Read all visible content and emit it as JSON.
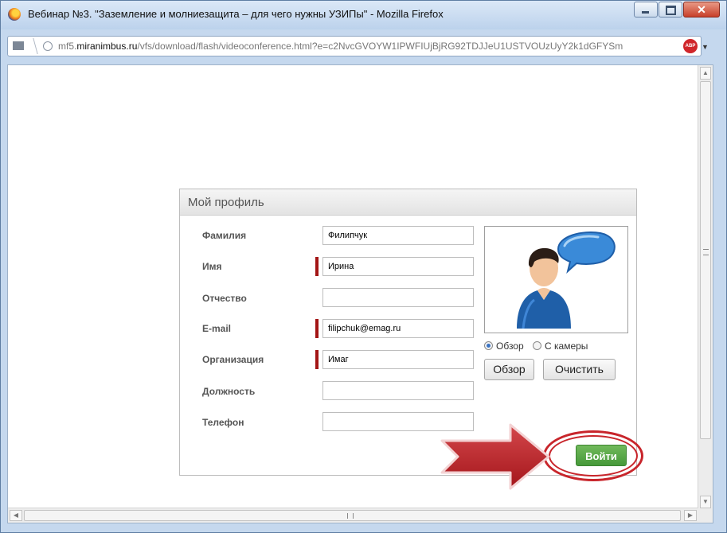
{
  "window": {
    "title": "Вебинар №3. \"Заземление и молниезащита – для чего нужны УЗИПы\" - Mozilla Firefox",
    "minimize_icon": "minimize-icon",
    "maximize_icon": "maximize-icon",
    "close_icon": "close-icon"
  },
  "urlbar": {
    "url_prefix": "mf5.",
    "url_domain": "miranimbus.ru",
    "url_path": "/vfs/download/flash/videoconference.html?e=c2NvcGVOYW1IPWFIUjBjRG92TDJJeU1USTVOUzUyY2k1dGFYSm",
    "adblock_label": "ABP"
  },
  "profile": {
    "header": "Мой профиль",
    "fields": [
      {
        "label": "Фамилия",
        "value": "Филипчук",
        "required": false
      },
      {
        "label": "Имя",
        "value": "Ирина",
        "required": true
      },
      {
        "label": "Отчество",
        "value": "",
        "required": false
      },
      {
        "label": "E-mail",
        "value": "filipchuk@emag.ru",
        "required": true
      },
      {
        "label": "Организация",
        "value": "Имаг",
        "required": true
      },
      {
        "label": "Должность",
        "value": "",
        "required": false
      },
      {
        "label": "Телефон",
        "value": "",
        "required": false
      }
    ],
    "photo_source": {
      "options": [
        "Обзор",
        "С камеры"
      ],
      "selected": "Обзор"
    },
    "browse_button": "Обзор",
    "clear_button": "Очистить",
    "login_button": "Войти"
  },
  "colors": {
    "required_marker": "#a31515",
    "login_button": "#4fa443",
    "annotation_red": "#c8252b"
  }
}
